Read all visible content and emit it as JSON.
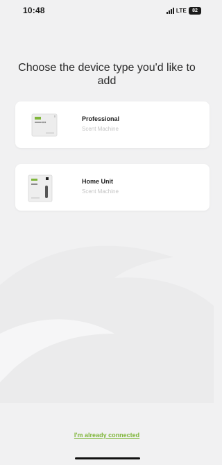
{
  "status_bar": {
    "time": "10:48",
    "network": "LTE",
    "battery": "82",
    "signal_icon": "signal-bars-icon"
  },
  "page": {
    "title": "Choose the device type you'd like to add"
  },
  "devices": [
    {
      "title": "Professional",
      "subtitle": "Scent Machine",
      "image_icon": "professional-scent-machine-image"
    },
    {
      "title": "Home Unit",
      "subtitle": "Scent Machine",
      "image_icon": "home-unit-scent-machine-image"
    }
  ],
  "footer": {
    "link_label": "I'm already connected"
  },
  "colors": {
    "background": "#f1f1f2",
    "card": "#ffffff",
    "accent_green": "#7fb63a",
    "subtitle_gray": "#c4c4c4"
  }
}
